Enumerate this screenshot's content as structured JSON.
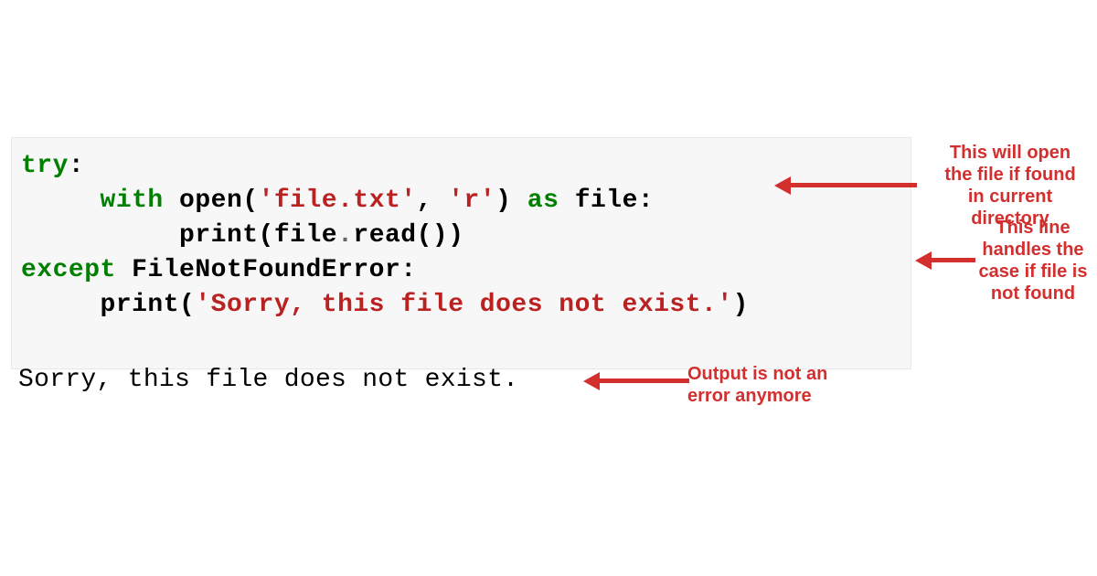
{
  "code": {
    "line1": {
      "try": "try",
      "colon": ":"
    },
    "line2": {
      "indent": "     ",
      "with": "with",
      "space1": " ",
      "open": "open",
      "paren1": "(",
      "arg1": "'file.txt'",
      "comma": ", ",
      "arg2": "'r'",
      "paren2": ")",
      "space2": " ",
      "as": "as",
      "space3": " ",
      "var": "file:"
    },
    "line3": {
      "indent": "          ",
      "print": "print",
      "paren1": "(",
      "file": "file",
      "dot": ".",
      "read": "read",
      "parens": "())"
    },
    "line4": {
      "except": "except",
      "space": " ",
      "err": "FileNotFoundError:"
    },
    "line5": {
      "indent": "     ",
      "print": "print",
      "paren1": "(",
      "msg": "'Sorry, this file does not exist.'",
      "paren2": ")"
    }
  },
  "output": "Sorry, this file does not exist.",
  "annotations": {
    "a1": "This will open\nthe file if found\nin current\ndirectory",
    "a2": "This line\nhandles the\ncase if file is\nnot found",
    "a3": "Output is not an\nerror anymore"
  },
  "colors": {
    "annotation": "#d32f2f",
    "keyword": "#008000",
    "string": "#ba2121",
    "codebg": "#f7f7f7"
  }
}
